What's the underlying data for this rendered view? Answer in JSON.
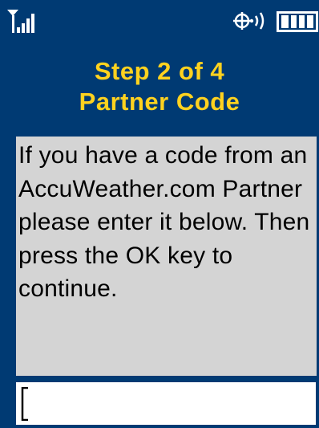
{
  "status_bar": {
    "signal_icon": "signal-strength-icon",
    "gps_icon": "gps-location-icon",
    "battery_icon": "battery-icon",
    "battery_level": 1.0
  },
  "header": {
    "line1": "Step 2 of 4",
    "line2": "Partner Code"
  },
  "body": {
    "text": "If you have a code from an AccuWeather.com Partner please enter it below. Then press the OK key to continue."
  },
  "partner_code": {
    "value": ""
  },
  "colors": {
    "background": "#003a73",
    "title": "#ffd21f",
    "panel": "#d4d4d4",
    "input": "#ffffff"
  }
}
